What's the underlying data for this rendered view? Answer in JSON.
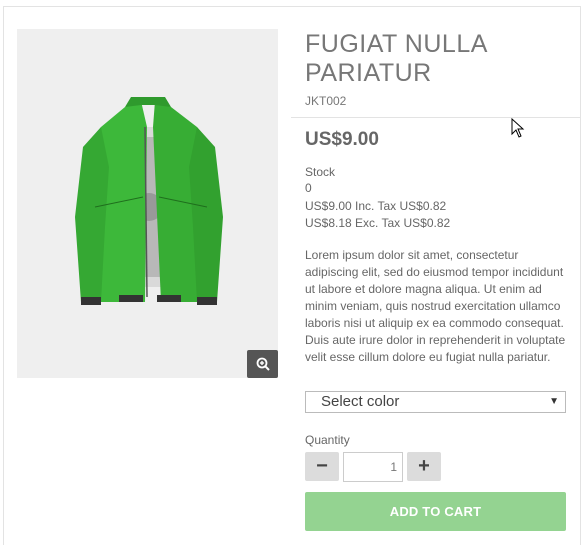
{
  "product": {
    "title": "FUGIAT NULLA PARIATUR",
    "sku": "JKT002",
    "price": "US$9.00",
    "stock_label": "Stock",
    "stock_value": "0",
    "tax_inc": "US$9.00 Inc. Tax US$0.82",
    "tax_exc": "US$8.18 Exc. Tax US$0.82",
    "description": "Lorem ipsum dolor sit amet, consectetur adipiscing elit, sed do eiusmod tempor incididunt ut labore et dolore magna aliqua. Ut enim ad minim veniam, quis nostrud exercitation ullamco laboris nisi ut aliquip ex ea commodo consequat. Duis aute irure dolor in reprehenderit in voluptate velit esse cillum dolore eu fugiat nulla pariatur."
  },
  "options": {
    "color_select_value": "Select color"
  },
  "quantity": {
    "label": "Quantity",
    "value": "1",
    "minus_symbol": "−",
    "plus_symbol": "+"
  },
  "actions": {
    "add_to_cart": "ADD TO CART"
  },
  "icons": {
    "zoom": "zoom-in-icon",
    "select_arrow": "▼"
  },
  "colors": {
    "add_to_cart_bg": "#94d391",
    "jacket_green": "#3db83a",
    "zoom_bg": "#555555"
  }
}
